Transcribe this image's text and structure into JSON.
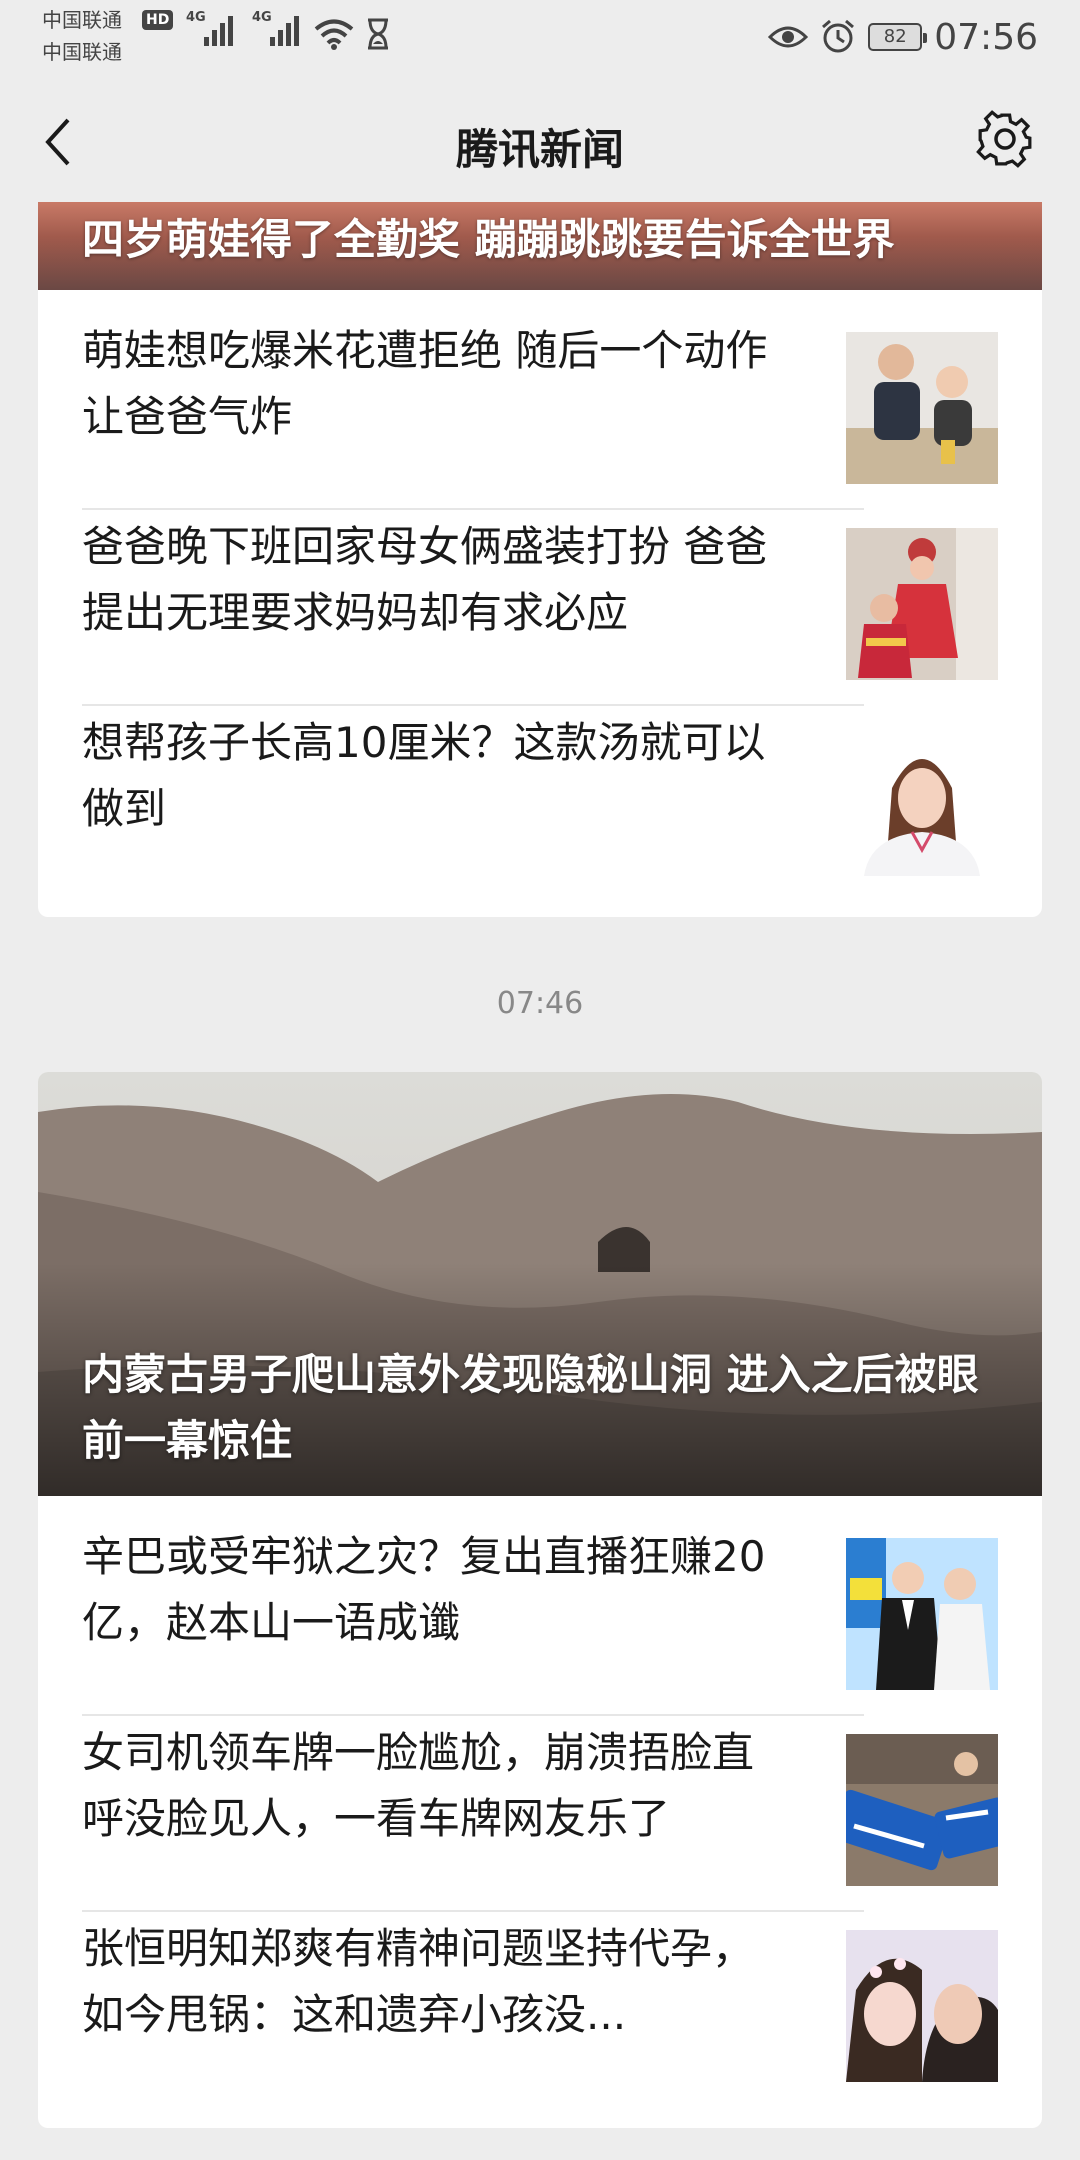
{
  "status_bar": {
    "carrier1": "中国联通",
    "carrier2": "中国联通",
    "hd": "HD",
    "net1": "4G",
    "net2": "4G",
    "battery": "82",
    "time": "07:56"
  },
  "nav": {
    "title": "腾讯新闻"
  },
  "group1": {
    "hero_title": "四岁萌娃得了全勤奖 蹦蹦跳跳要告诉全世界",
    "items": [
      {
        "title": "萌娃想吃爆米花遭拒绝 随后一个动作让爸爸气炸"
      },
      {
        "title": "爸爸晚下班回家母女俩盛装打扮  爸爸提出无理要求妈妈却有求必应"
      },
      {
        "title": "想帮孩子长高10厘米？这款汤就可以做到"
      }
    ]
  },
  "timestamp": "07:46",
  "group2": {
    "hero_title": "内蒙古男子爬山意外发现隐秘山洞 进入之后被眼前一幕惊住",
    "items": [
      {
        "title": "辛巴或受牢狱之灾？复出直播狂赚20亿，赵本山一语成谶"
      },
      {
        "title": "女司机领车牌一脸尴尬，崩溃捂脸直呼没脸见人，一看车牌网友乐了"
      },
      {
        "title": "张恒明知郑爽有精神问题坚持代孕，如今甩锅：这和遗弃小孩没..."
      }
    ]
  },
  "colors": {
    "background": "#ededed",
    "card": "#ffffff",
    "text": "#1a1a1a",
    "timestamp": "#888888"
  }
}
